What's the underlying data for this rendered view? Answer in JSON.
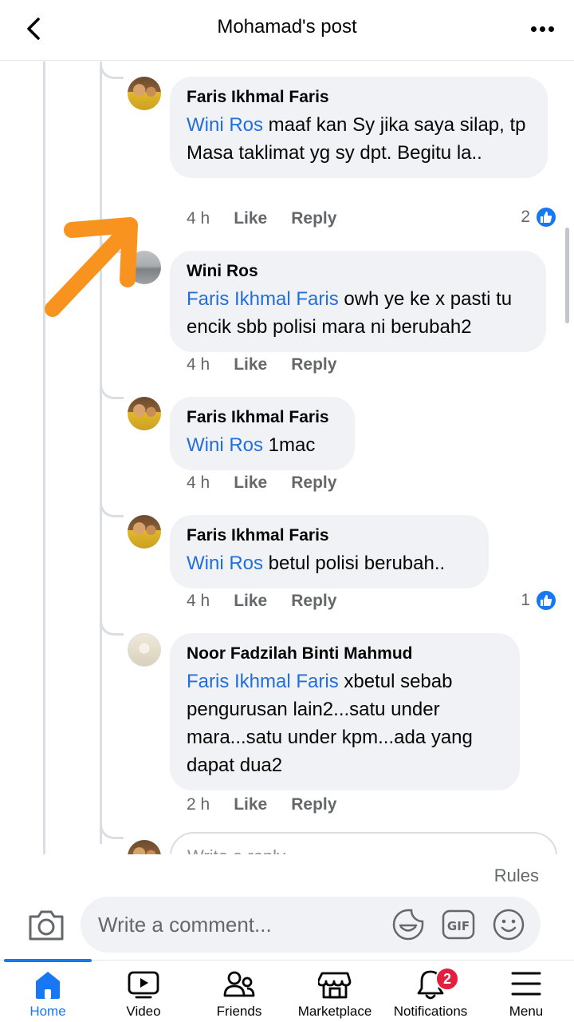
{
  "header": {
    "title": "Mohamad's post"
  },
  "comments": [
    {
      "author": "Faris Ikhmal Faris",
      "mention": "Wini Ros",
      "text": " maaf kan Sy jika saya silap, tp Masa taklimat yg sy dpt. Begitu la..",
      "time": "4 h",
      "like": "Like",
      "reply": "Reply",
      "reactions": "2"
    },
    {
      "author": "Wini Ros",
      "mention": "Faris Ikhmal Faris",
      "text": " owh ye ke x pasti tu encik sbb polisi mara ni berubah2",
      "time": "4 h",
      "like": "Like",
      "reply": "Reply"
    },
    {
      "author": "Faris Ikhmal Faris",
      "mention": "Wini Ros",
      "text": " 1mac",
      "time": "4 h",
      "like": "Like",
      "reply": "Reply"
    },
    {
      "author": "Faris Ikhmal Faris",
      "mention": "Wini Ros",
      "text": " betul polisi berubah..",
      "time": "4 h",
      "like": "Like",
      "reply": "Reply",
      "reactions": "1"
    },
    {
      "author": "Noor Fadzilah Binti Mahmud",
      "mention": "Faris Ikhmal Faris",
      "text": " xbetul sebab pengurusan lain2...satu under mara...satu under kpm...ada yang dapat dua2",
      "time": "2 h",
      "like": "Like",
      "reply": "Reply"
    }
  ],
  "reply_box": {
    "placeholder": "Write a reply..."
  },
  "composer": {
    "rules": "Rules",
    "placeholder": "Write a comment..."
  },
  "nav": {
    "home": "Home",
    "video": "Video",
    "friends": "Friends",
    "marketplace": "Marketplace",
    "notifications": "Notifications",
    "notifications_badge": "2",
    "menu": "Menu"
  },
  "colors": {
    "accent": "#1877f2",
    "mention": "#216fdb",
    "annotation_arrow": "#f7931e",
    "badge": "#e41e3f"
  }
}
